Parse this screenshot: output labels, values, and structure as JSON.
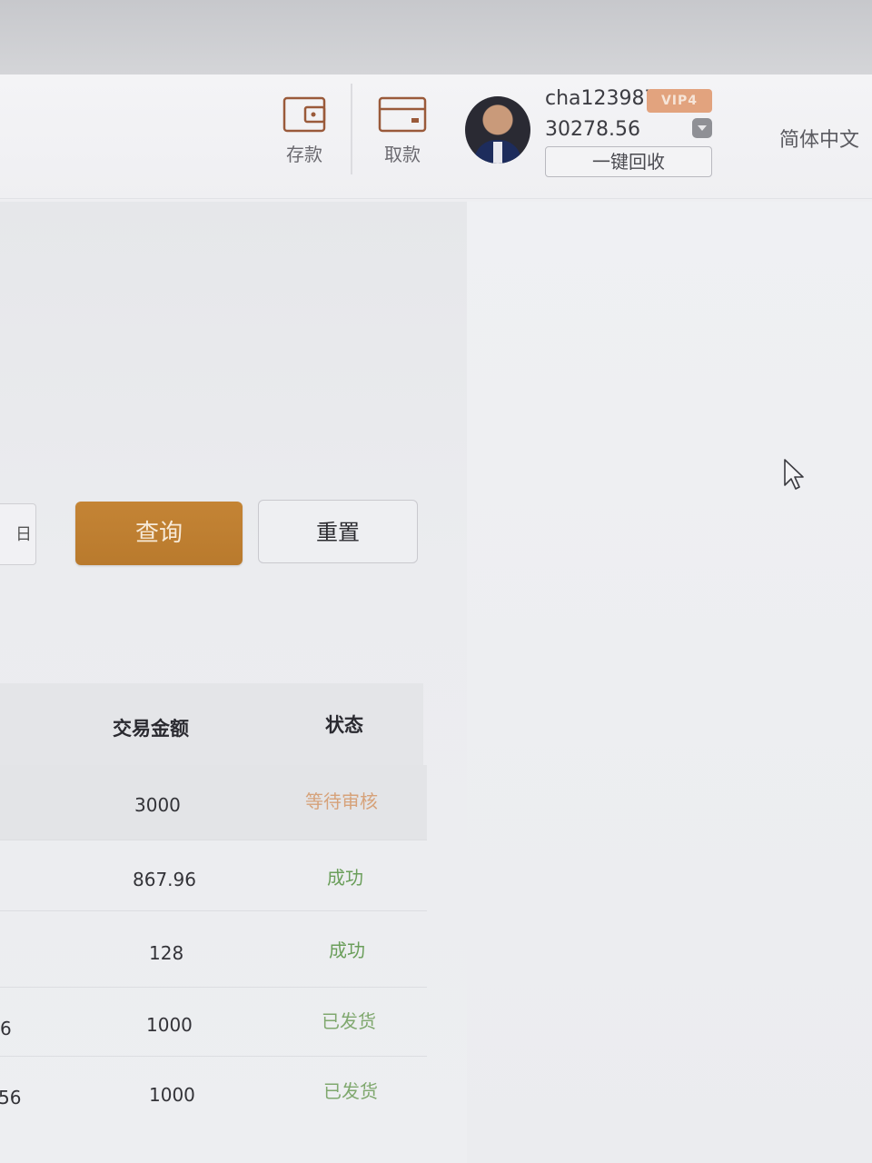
{
  "header": {
    "deposit_label": "存款",
    "withdraw_label": "取款",
    "username": "cha123987",
    "vip_badge": "VIP4",
    "balance": "30278.56",
    "recycle_label": "一键回收",
    "language": "简体中文"
  },
  "filters": {
    "date_fragment": "日",
    "query_label": "查询",
    "reset_label": "重置"
  },
  "table": {
    "columns": [
      "交易金额",
      "状态"
    ],
    "rows": [
      {
        "left_fragment": "",
        "amount": "3000",
        "status": "等待审核",
        "status_color": "#d6a27a"
      },
      {
        "left_fragment": "",
        "amount": "867.96",
        "status": "成功",
        "status_color": "#6a9e5a"
      },
      {
        "left_fragment": "",
        "amount": "128",
        "status": "成功",
        "status_color": "#6a9e5a"
      },
      {
        "left_fragment": "6",
        "amount": "1000",
        "status": "已发货",
        "status_color": "#7fa86e"
      },
      {
        "left_fragment": "56",
        "amount": "1000",
        "status": "已发货",
        "status_color": "#7fa86e"
      }
    ]
  },
  "colors": {
    "accent": "#c07f32",
    "vip": "#e2a37e"
  }
}
